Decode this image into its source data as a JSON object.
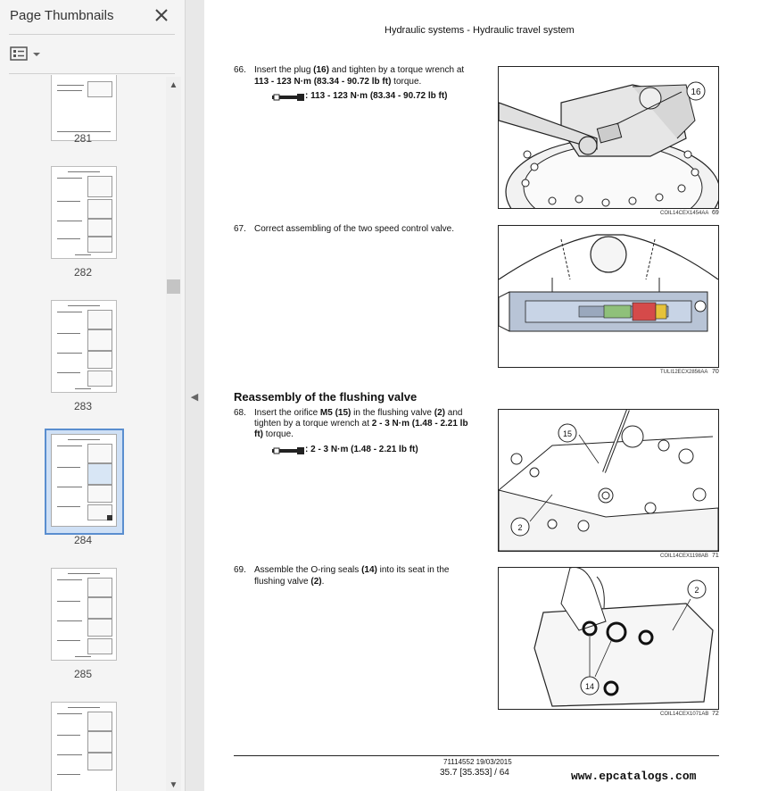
{
  "sidebar": {
    "title": "Page Thumbnails",
    "close_icon": "close-icon",
    "options_icon": "thumbnail-options-icon",
    "pages": [
      "281",
      "282",
      "283",
      "284",
      "285"
    ],
    "selected_page": "284"
  },
  "document": {
    "header": "Hydraulic systems - Hydraulic travel system",
    "step66": {
      "num": "66.",
      "line1a": "Insert the plug ",
      "line1b": "(16)",
      "line1c": " and tighten by a torque wrench at",
      "line2a": "113 - 123 N·m (83.34 - 90.72 lb ft)",
      "line2b": " torque.",
      "torque": ": 113 - 123 N·m (83.34 - 90.72 lb ft)",
      "callout": "16",
      "caption": "COIL14CEX1454AA",
      "fig_no": "69"
    },
    "step67": {
      "num": "67.",
      "text": "Correct assembling of the two speed control valve.",
      "caption": "TULI12ECX2856AA",
      "fig_no": "70"
    },
    "section_heading": "Reassembly of the flushing valve",
    "step68": {
      "num": "68.",
      "line1a": "Insert the orifice ",
      "line1b": "M5 (15)",
      "line1c": " in the flushing valve ",
      "line1d": "(2)",
      "line1e": " and",
      "line2a": "tighten by a torque wrench at ",
      "line2b": "2 - 3 N·m (1.48 - 2.21 lb",
      "line3a": "ft)",
      "line3b": " torque.",
      "torque": ": 2 - 3 N·m (1.48 - 2.21 lb ft)",
      "callout_a": "15",
      "callout_b": "2",
      "caption": "COIL14CEX1198AB",
      "fig_no": "71"
    },
    "step69": {
      "num": "69.",
      "line1a": "Assemble the O-ring seals ",
      "line1b": "(14)",
      "line1c": " into its seat in the",
      "line2a": "flushing valve ",
      "line2b": "(2)",
      "line2c": ".",
      "callout_a": "2",
      "callout_b": "14",
      "caption": "COIL14CEX1071AB",
      "fig_no": "72"
    },
    "footer": {
      "doc_no": "71114552 19/03/2015",
      "page_ref": "35.7 [35.353] / 64"
    },
    "watermark": "www.epcatalogs.com"
  }
}
